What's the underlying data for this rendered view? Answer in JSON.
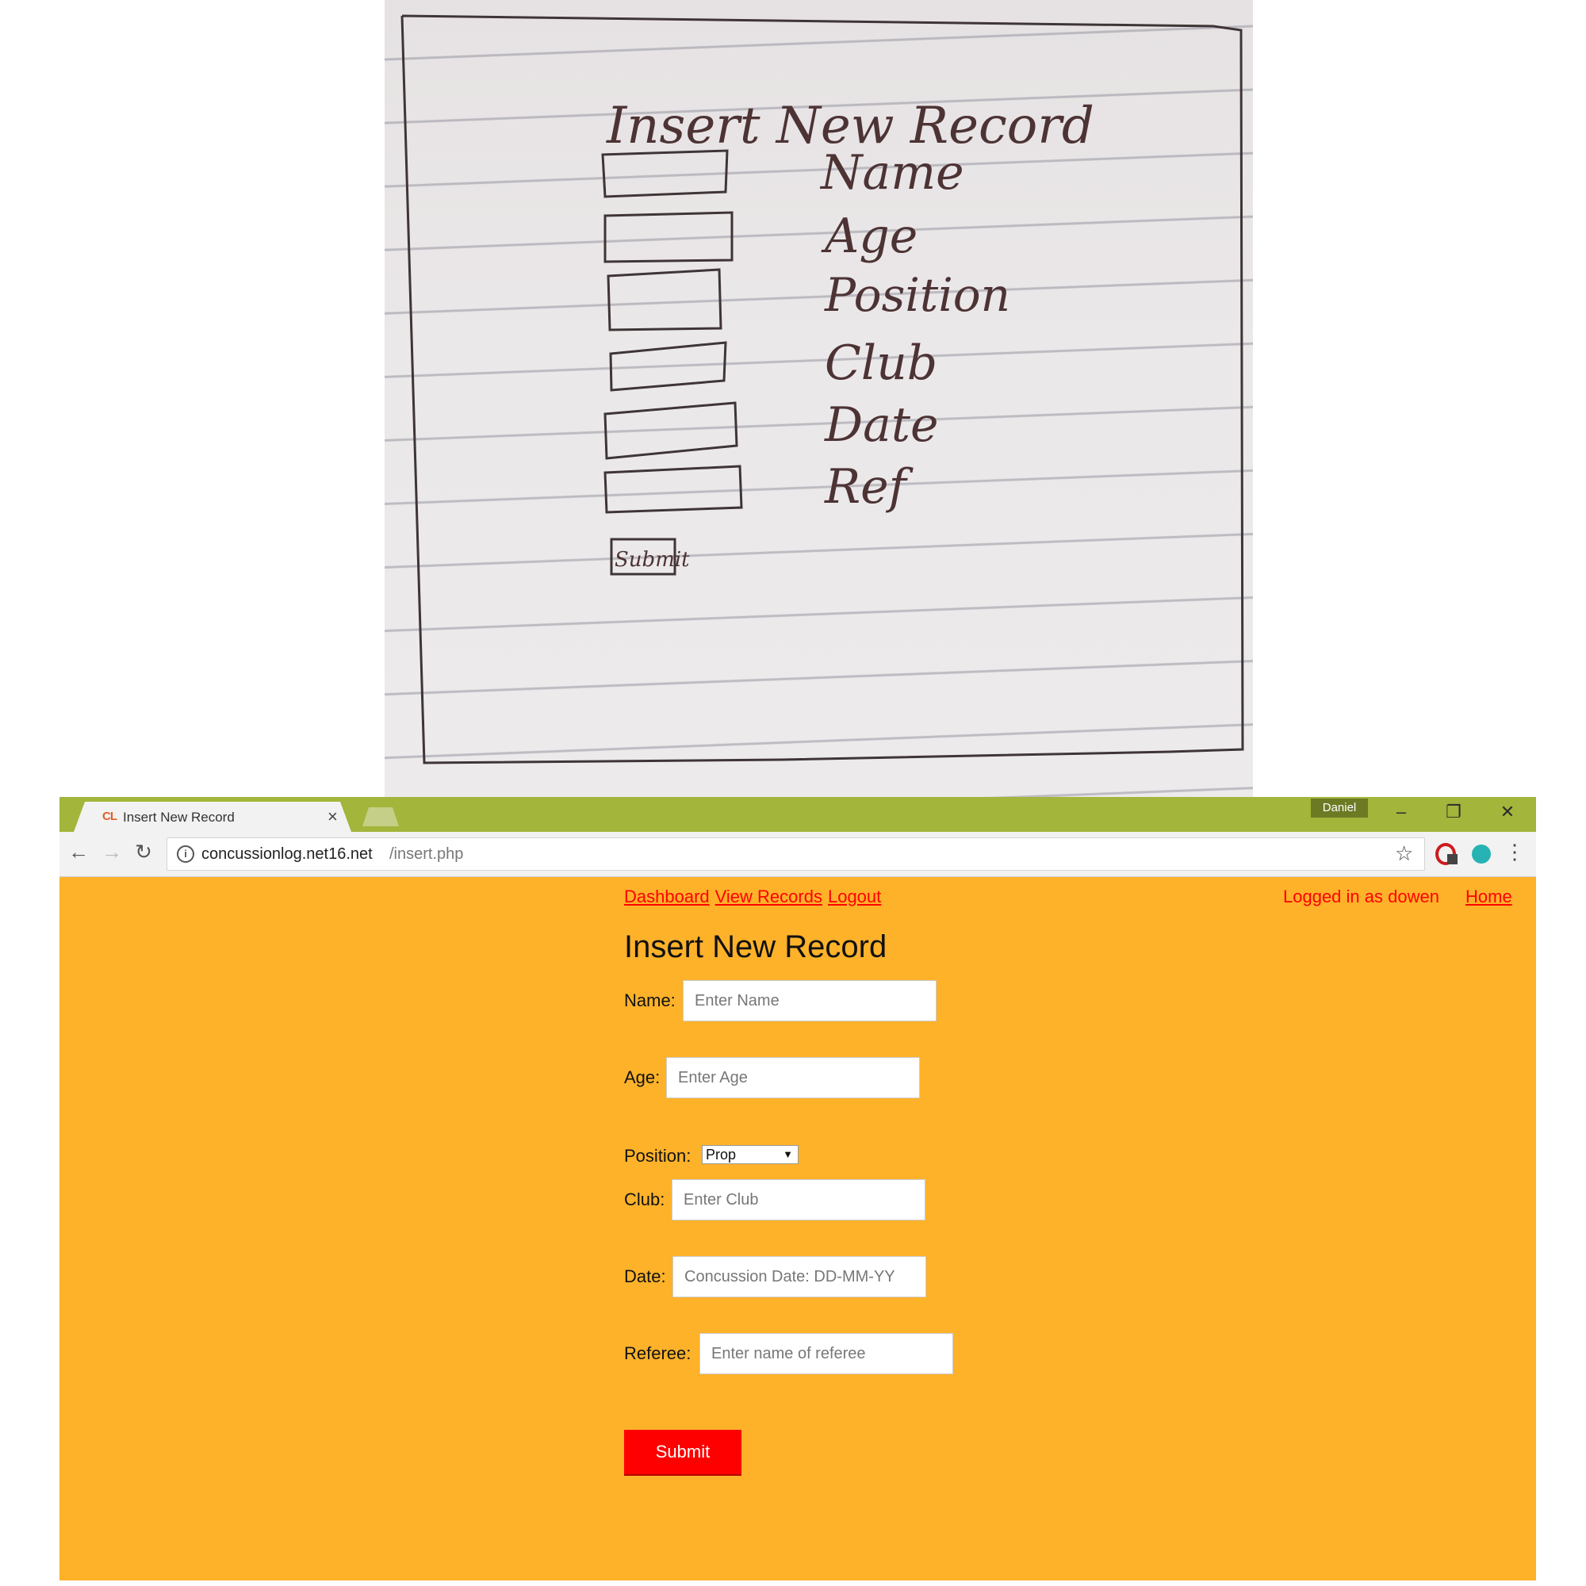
{
  "sketch": {
    "title": "Insert New Record",
    "fields": [
      "Name",
      "Age",
      "Position",
      "Club",
      "Date",
      "Ref"
    ],
    "submit_label": "Submit"
  },
  "browser": {
    "tab_title": "Insert New Record",
    "tab_favicon": "CL",
    "profile_name": "Daniel",
    "url_host": "concussionlog.net16.net",
    "url_path": "/insert.php",
    "colors": {
      "tabbar": "#a3b53a",
      "page_bg": "#fdb22a",
      "link": "#ff0000",
      "submit_bg": "#ff0000"
    }
  },
  "page": {
    "nav": {
      "dashboard": "Dashboard",
      "view_records": "View Records",
      "logout": "Logout"
    },
    "login_status": "Logged in as dowen",
    "home": "Home",
    "title": "Insert New Record",
    "form": {
      "name_label": "Name:",
      "name_placeholder": "Enter Name",
      "age_label": "Age:",
      "age_placeholder": "Enter Age",
      "position_label": "Position:",
      "position_value": "Prop",
      "club_label": "Club:",
      "club_placeholder": "Enter Club",
      "date_label": "Date:",
      "date_placeholder": "Concussion Date: DD-MM-YY",
      "referee_label": "Referee:",
      "referee_placeholder": "Enter name of referee",
      "submit_label": "Submit"
    }
  }
}
